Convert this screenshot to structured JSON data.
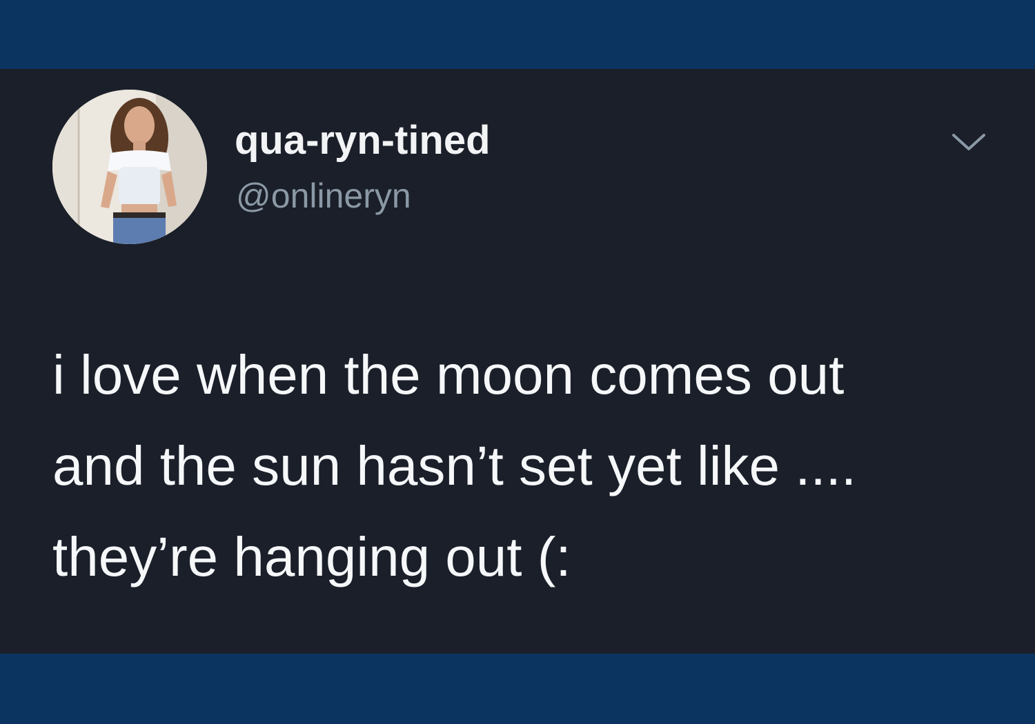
{
  "tweet": {
    "author": {
      "display_name": "qua-ryn-tined",
      "handle": "@onlineryn",
      "avatar_icon": "profile-photo"
    },
    "menu_icon": "chevron-down-icon",
    "text": "i love when the moon comes out\nand the sun hasn’t set yet like ....\nthey’re hanging out (:"
  },
  "colors": {
    "frame_background": "#0c3461",
    "card_background": "#1a1f29",
    "primary_text": "#f2f3f5",
    "secondary_text": "#8b98a5"
  }
}
